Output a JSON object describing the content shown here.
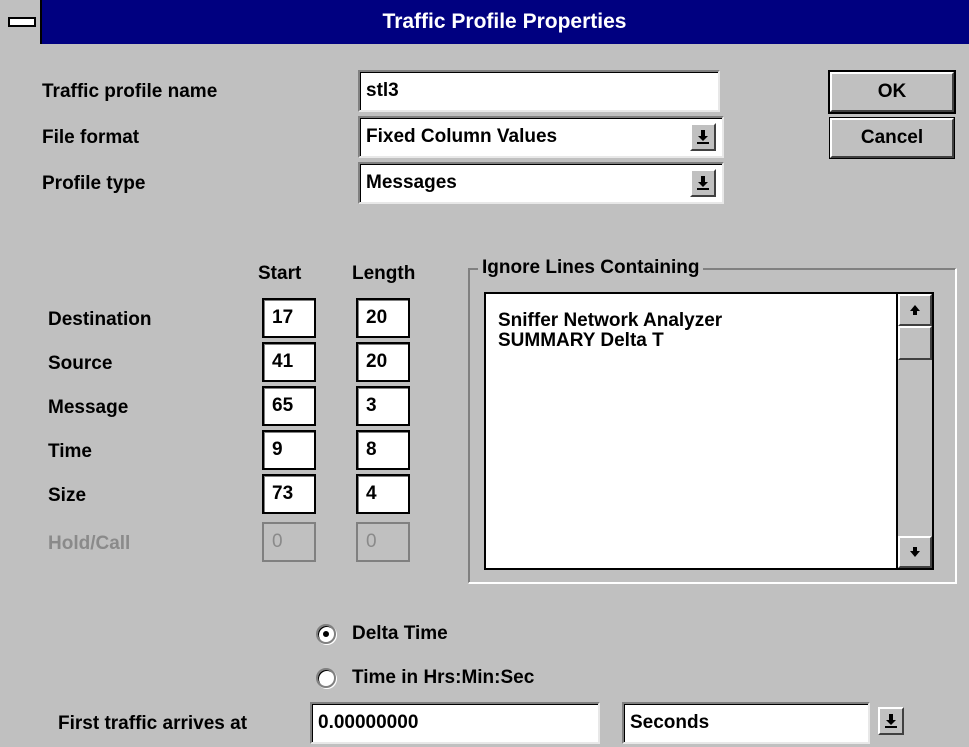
{
  "window": {
    "title": "Traffic Profile Properties"
  },
  "form": {
    "profile_name": {
      "label": "Traffic profile name",
      "value": "stl3"
    },
    "file_format": {
      "label": "File format",
      "value": "Fixed Column Values"
    },
    "profile_type": {
      "label": "Profile type",
      "value": "Messages"
    }
  },
  "buttons": {
    "ok": "OK",
    "cancel": "Cancel"
  },
  "columns": {
    "start_header": "Start",
    "length_header": "Length",
    "rows": [
      {
        "label": "Destination",
        "start": "17",
        "length": "20",
        "enabled": true
      },
      {
        "label": "Source",
        "start": "41",
        "length": "20",
        "enabled": true
      },
      {
        "label": "Message",
        "start": "65",
        "length": "3",
        "enabled": true
      },
      {
        "label": "Time",
        "start": "9",
        "length": "8",
        "enabled": true
      },
      {
        "label": "Size",
        "start": "73",
        "length": "4",
        "enabled": true
      },
      {
        "label": "Hold/Call",
        "start": "0",
        "length": "0",
        "enabled": false
      }
    ]
  },
  "ignore_lines": {
    "legend": "Ignore Lines Containing",
    "items": [
      "Sniffer Network Analyzer",
      "SUMMARY  Delta T"
    ]
  },
  "time_mode": {
    "options": [
      {
        "label": "Delta Time",
        "selected": true
      },
      {
        "label": "Time in Hrs:Min:Sec",
        "selected": false
      }
    ]
  },
  "first_traffic": {
    "label": "First traffic arrives at",
    "value": "0.00000000",
    "unit": "Seconds"
  },
  "icons": {
    "dropdown": "down-arrow-underscore-icon",
    "scroll_up": "up-arrow-icon",
    "scroll_down": "down-arrow-icon",
    "system_menu": "system-menu-icon"
  },
  "colors": {
    "titlebar": "#000080",
    "face": "#c0c0c0",
    "disabled_text": "#8a8a8a"
  }
}
